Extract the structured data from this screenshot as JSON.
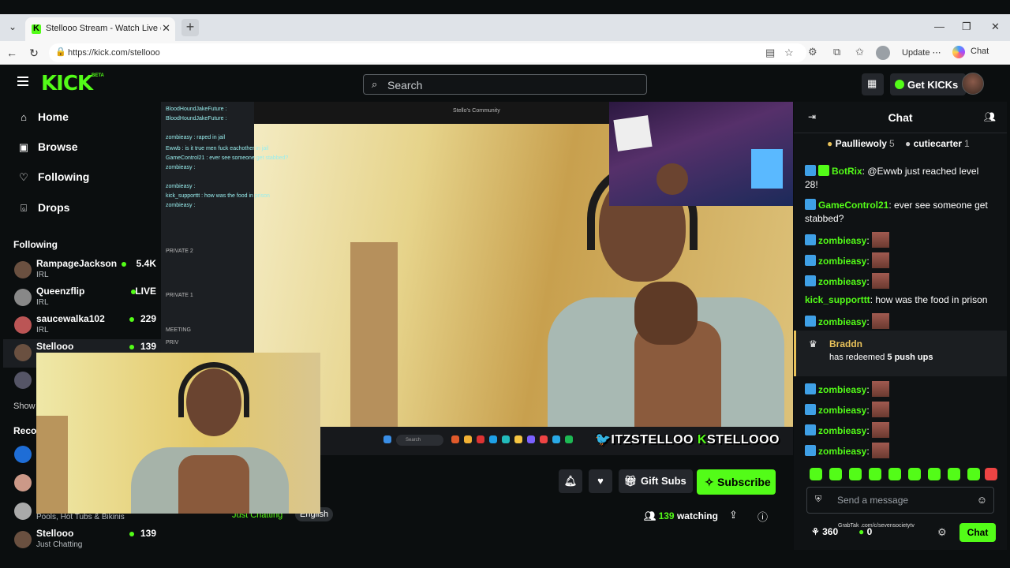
{
  "browser": {
    "tab_title": "Stellooo Stream - Watch Live on K",
    "url": "https://kick.com/stellooo",
    "update_label": "Update",
    "chat_label": "Chat"
  },
  "header": {
    "logo": "KICK",
    "logo_badge": "BETA",
    "search_placeholder": "Search",
    "get_kicks": "Get KICKs"
  },
  "sidebar": {
    "nav": [
      {
        "label": "Home",
        "icon": "home-icon"
      },
      {
        "label": "Browse",
        "icon": "browse-icon"
      },
      {
        "label": "Following",
        "icon": "heart-icon"
      },
      {
        "label": "Drops",
        "icon": "gift-icon"
      }
    ],
    "following_heading": "Following",
    "channels": [
      {
        "name": "RampageJackson",
        "category": "IRL",
        "viewers": "5.4K"
      },
      {
        "name": "Queenzflip",
        "category": "IRL",
        "viewers": "LIVE"
      },
      {
        "name": "saucewalka102",
        "category": "IRL",
        "viewers": "229"
      },
      {
        "name": "Stellooo",
        "category": "",
        "viewers": "139"
      }
    ],
    "show_more": "Show",
    "recommended_heading": "Reco",
    "recommended_last_category": "Pools, Hot Tubs & Bikinis",
    "bottom_channel": {
      "name": "Stellooo",
      "category": "Just Chatting",
      "viewers": "139"
    }
  },
  "video": {
    "overlay_top_title": "Stello's Community",
    "social_prefix": "ITZSTELLOO",
    "social_suffix": "STELLOOO",
    "taskbar_search": "Search",
    "overlay_chat": [
      "BloodHoundJakeFuture :",
      "BloodHoundJakeFuture :",
      "zombieasy : raped in jail",
      "Ewwb : is it true men fuck eachother in jail",
      "GameControl21 : ever see someone get stabbed?",
      "zombieasy :",
      "zombieasy :",
      "kick_supporttt : how was the food in prison",
      "zombieasy :",
      "PRIVATE 2",
      "PRIVATE 1",
      "MEETING",
      "PRIV"
    ]
  },
  "below_video": {
    "gift_subs": "Gift Subs",
    "subscribe": "Subscribe",
    "viewers": "139",
    "watching_label": "watching",
    "tag_category": "Just Chatting",
    "tag_language": "English"
  },
  "chat": {
    "title": "Chat",
    "top_gifters": [
      {
        "name": "Paulliewoly",
        "count": "5"
      },
      {
        "name": "cutiecarter",
        "count": "1"
      }
    ],
    "messages": [
      {
        "user": "BotRix",
        "color": "#53fc18",
        "text": "@Ewwb just reached level 28!"
      },
      {
        "user": "GameControl21",
        "color": "#53fc18",
        "text": "ever see someone get stabbed?"
      },
      {
        "user": "zombieasy",
        "color": "#53fc18",
        "text": ""
      },
      {
        "user": "zombieasy",
        "color": "#53fc18",
        "text": ""
      },
      {
        "user": "zombieasy",
        "color": "#53fc18",
        "text": ""
      },
      {
        "user": "kick_supporttt",
        "color": "#53fc18",
        "text": "how was the food in prison"
      },
      {
        "user": "zombieasy",
        "color": "#53fc18",
        "text": ""
      }
    ],
    "redeem": {
      "user": "Braddn",
      "text_prefix": "has redeemed",
      "reward": "5 push ups"
    },
    "messages_after": [
      {
        "user": "zombieasy",
        "text": ""
      },
      {
        "user": "zombieasy",
        "text": ""
      },
      {
        "user": "zombieasy",
        "text": ""
      },
      {
        "user": "zombieasy",
        "text": ""
      }
    ],
    "input_placeholder": "Send a message",
    "points": "360",
    "kicks": "0",
    "send_label": "Chat",
    "watermark": "GrabTak .com/c/sevensocietytv"
  }
}
